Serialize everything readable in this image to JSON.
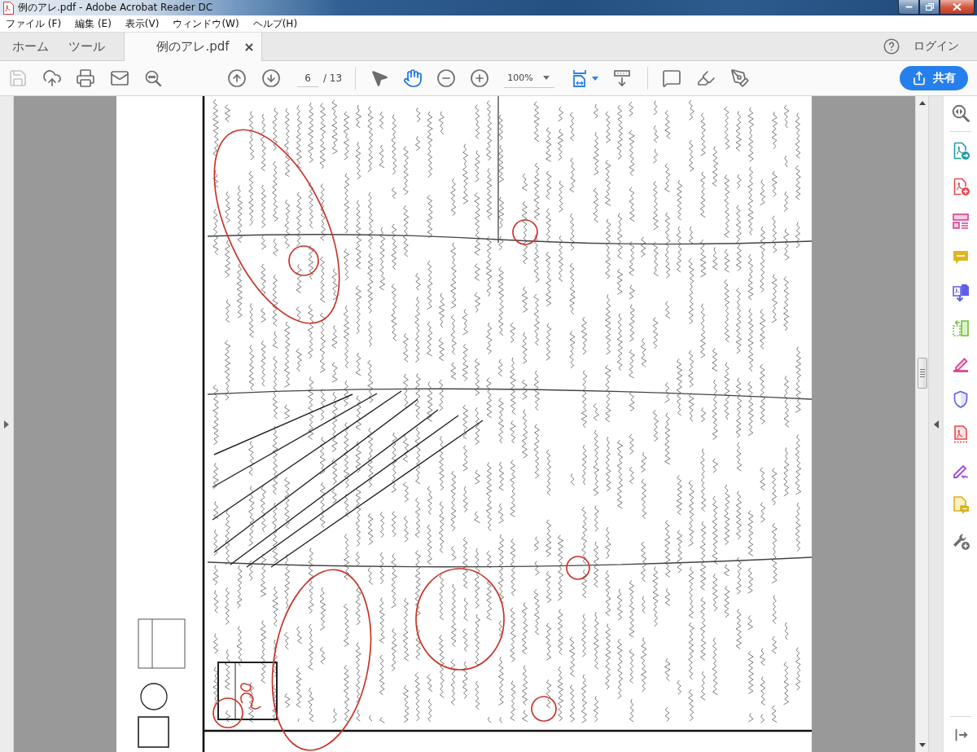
{
  "window": {
    "title": "例のアレ.pdf - Adobe Acrobat Reader DC"
  },
  "menu": [
    "ファイル (F)",
    "編集 (E)",
    "表示(V)",
    "ウィンドウ(W)",
    "ヘルプ(H)"
  ],
  "tabs": [
    {
      "kind": "nav",
      "label": "ホーム",
      "selected": false
    },
    {
      "kind": "nav",
      "label": "ツール",
      "selected": false
    },
    {
      "kind": "document",
      "label": "例のアレ.pdf",
      "close": "×",
      "selected": true
    }
  ],
  "account": {
    "login": "ログイン"
  },
  "toolbar": {
    "file_tools": [
      {
        "kind": "save",
        "disabled": true
      },
      {
        "kind": "upload",
        "disabled": false
      },
      {
        "kind": "print",
        "disabled": false
      },
      {
        "kind": "mail",
        "disabled": false
      },
      {
        "kind": "search",
        "disabled": false
      }
    ],
    "page_nav": [
      {
        "kind": "previous"
      },
      {
        "kind": "next"
      }
    ],
    "page": {
      "current": "6",
      "total": "/ 13"
    },
    "modes": [
      {
        "kind": "select",
        "selected": false
      },
      {
        "kind": "hand",
        "selected": true
      }
    ],
    "zoom_buttons": [
      {
        "kind": "zoom-out"
      },
      {
        "kind": "zoom-in"
      }
    ],
    "zoom": {
      "value": "100%"
    },
    "view_tools": [
      {
        "kind": "fit-page",
        "menu": true
      },
      {
        "kind": "scroll-mode",
        "menu": false
      }
    ],
    "annotate_tools": [
      {
        "kind": "comment"
      },
      {
        "kind": "highlight"
      },
      {
        "kind": "sign"
      }
    ],
    "share": {
      "label": "共有"
    }
  },
  "left_pane": {
    "expanded": false
  },
  "tools_pane": {
    "expanded": false,
    "tools": [
      {
        "kind": "enhance-scan"
      },
      {
        "kind": "export-pdf"
      },
      {
        "kind": "create-pdf"
      },
      {
        "kind": "organize-pages"
      },
      {
        "kind": "comment"
      },
      {
        "kind": "combine-files"
      },
      {
        "kind": "scan"
      },
      {
        "kind": "fill-sign"
      },
      {
        "kind": "protect"
      },
      {
        "kind": "edit-pdf"
      },
      {
        "kind": "sign"
      },
      {
        "kind": "send-comments"
      },
      {
        "kind": "more-tools"
      }
    ]
  }
}
